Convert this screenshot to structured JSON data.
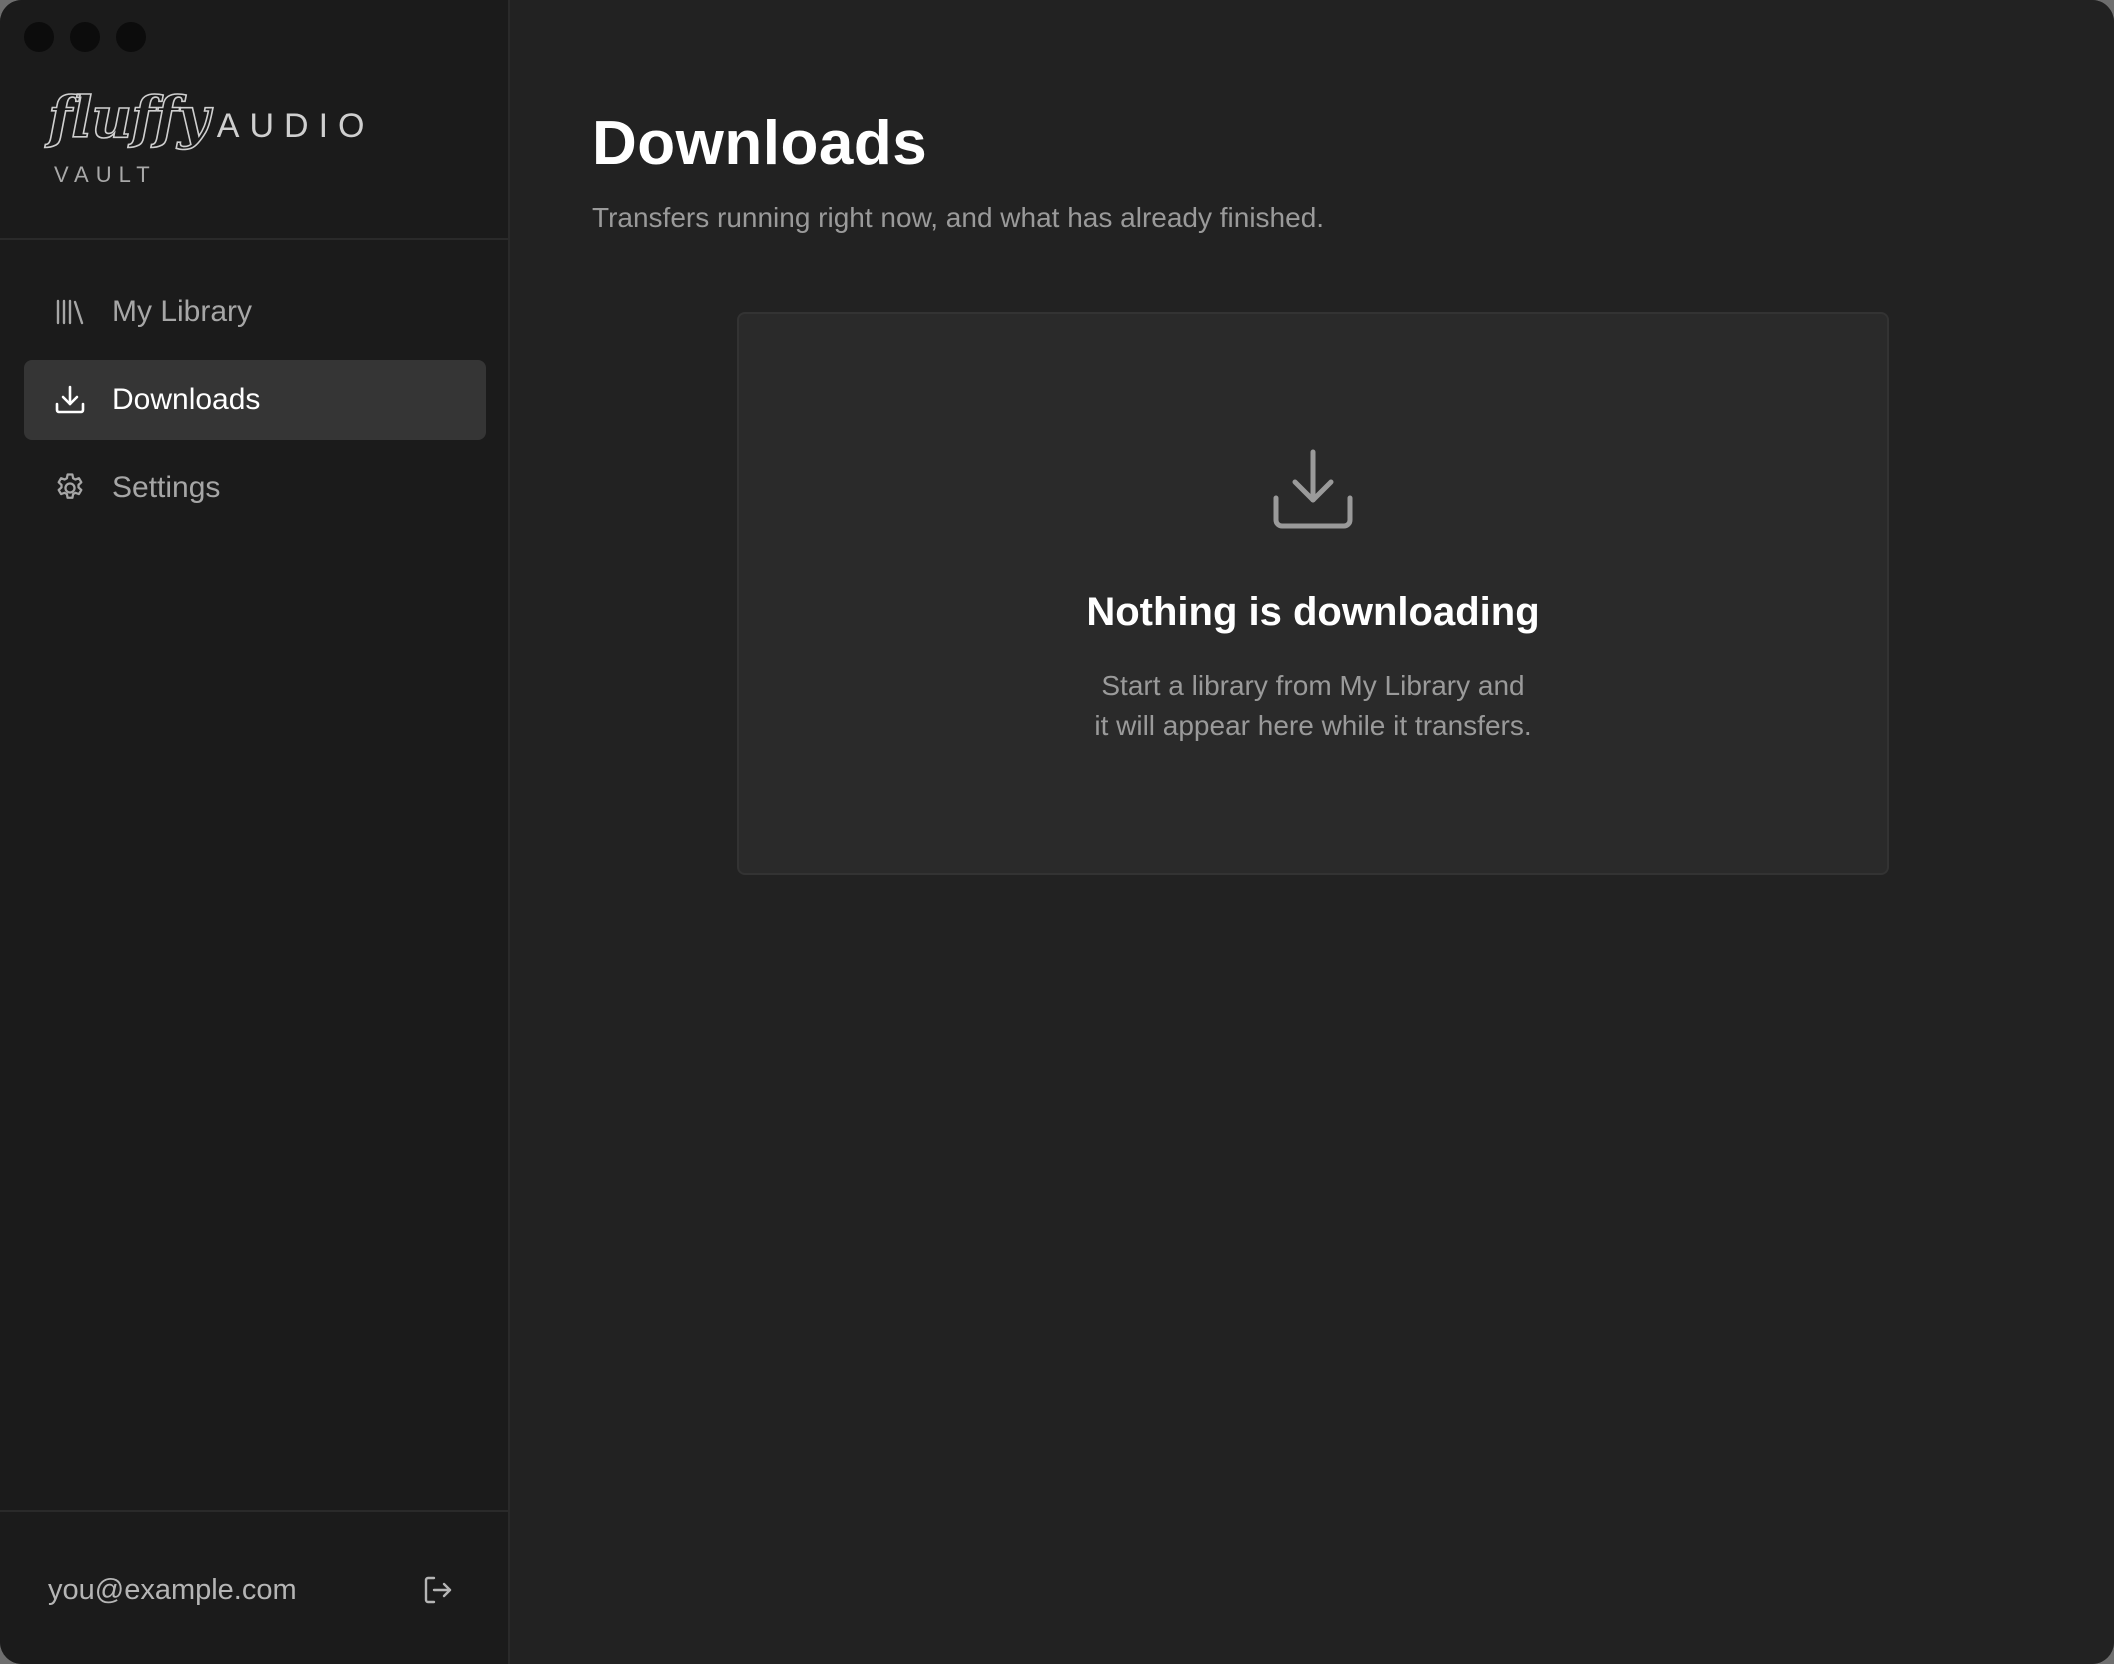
{
  "window": {
    "traffic_lights": [
      "close",
      "minimize",
      "zoom"
    ]
  },
  "brand": {
    "script": "fluffy",
    "word": "AUDIO",
    "sub": "VAULT"
  },
  "sidebar": {
    "items": [
      {
        "label": "My Library",
        "icon": "library-icon",
        "active": false
      },
      {
        "label": "Downloads",
        "icon": "download-icon",
        "active": true
      },
      {
        "label": "Settings",
        "icon": "gear-icon",
        "active": false
      }
    ],
    "account": {
      "email": "you@example.com",
      "logout_icon": "logout-icon"
    }
  },
  "main": {
    "title": "Downloads",
    "subtitle": "Transfers running right now, and what has already finished.",
    "empty_state": {
      "icon": "download-icon",
      "title": "Nothing is downloading",
      "line1": "Start a library from My Library and",
      "line2": "it will appear here while it transfers."
    }
  },
  "colors": {
    "window_bg": "#222222",
    "sidebar_bg": "#1b1b1b",
    "active_item_bg": "#353535",
    "card_bg": "#2a2a2a",
    "text_primary": "#ffffff",
    "text_muted": "#9a9a9a"
  }
}
